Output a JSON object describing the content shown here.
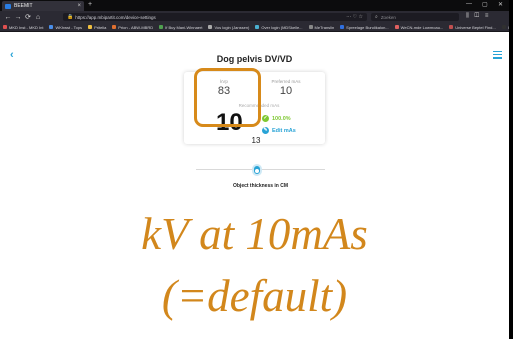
{
  "browser": {
    "tab_title": "BEEMIT",
    "new_tab": "+",
    "url": "https://app.mbipartit.com/device-settings",
    "search_placeholder": "Zoeken",
    "nav": {
      "back": "←",
      "forward": "→",
      "reload": "⟳",
      "home": "⌂"
    },
    "bookmarks": [
      {
        "label": "MKD Inst - MKD Int",
        "color": "#e05050"
      },
      {
        "label": "WKhwst - Tops",
        "color": "#4a8ee8"
      },
      {
        "label": "Pritelia",
        "color": "#f0c040"
      },
      {
        "label": "Prion - ABW-MBRD",
        "color": "#e07030"
      },
      {
        "label": "If Buy Mani-Winnaert",
        "color": "#50a050"
      },
      {
        "label": "Vos login (Janssen)",
        "color": "#aaaaaa"
      },
      {
        "label": "Over login (MDSkelle...",
        "color": "#4ab0d0"
      },
      {
        "label": "MeTranslin",
        "color": "#888888"
      },
      {
        "label": "Spreelage Bundikalon...",
        "color": "#3070e0"
      },
      {
        "label": "WeCN-mde Lowmoau...",
        "color": "#e06060"
      },
      {
        "label": "Universe Beptel Find...",
        "color": "#c05050"
      },
      {
        "label": "Installation - Architec...",
        "color": "#303030"
      },
      {
        "label": "Lab-tbl Color Definitions",
        "color": "#40a0e0"
      }
    ]
  },
  "page": {
    "back_icon": "‹",
    "title": "Dog pelvis DV/VD",
    "card": {
      "kv_label": "kVp",
      "kv_value": "83",
      "preferred_label": "Preferred mAs",
      "preferred_value": "10",
      "recommended_label": "Recommended mAs",
      "recommended_value": "10",
      "badge_pct": "100.0%",
      "badge_color": "#7ec832",
      "edit_label": "Edit mAs",
      "edit_color": "#28a3d6"
    },
    "slider": {
      "value": "13",
      "label": "Object thickness in CM",
      "position": 0.45
    }
  },
  "overlay": {
    "line1": "kV at 10mAs",
    "line2": "(=default)",
    "color": "#d2871c"
  },
  "colors": {
    "accent": "#28a3d6",
    "highlight": "#d78a1a"
  }
}
